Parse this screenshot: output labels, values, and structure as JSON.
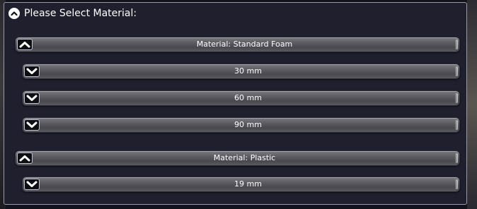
{
  "panel": {
    "title": "Please Select Material:",
    "header_icon": "chevron-up-circle-icon"
  },
  "materials": [
    {
      "label": "Material: Standard Foam",
      "toggle_icon": "chevron-up-icon",
      "expanded": true,
      "thicknesses": [
        {
          "label": "30 mm",
          "toggle_icon": "chevron-down-icon"
        },
        {
          "label": "60 mm",
          "toggle_icon": "chevron-down-icon"
        },
        {
          "label": "90 mm",
          "toggle_icon": "chevron-down-icon"
        }
      ]
    },
    {
      "label": "Material: Plastic",
      "toggle_icon": "chevron-up-icon",
      "expanded": true,
      "thicknesses": [
        {
          "label": "19 mm",
          "toggle_icon": "chevron-down-icon"
        }
      ]
    }
  ],
  "colors": {
    "panel_background": "#1f1f2e",
    "panel_border": "#9a9aa6",
    "bar_fill": "#5e5e64",
    "text": "#ffffff"
  }
}
